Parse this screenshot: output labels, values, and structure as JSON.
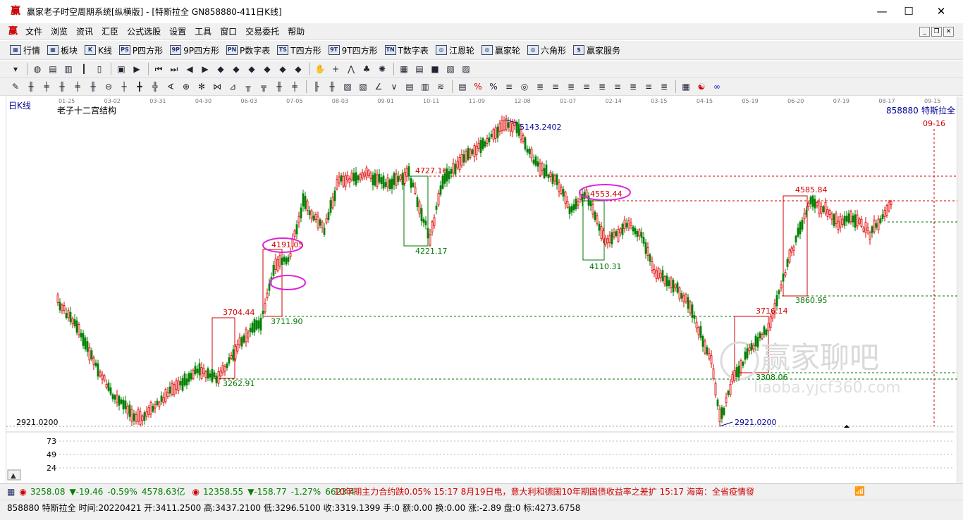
{
  "window": {
    "title": "赢家老子时空周期系统[纵横版] - [特斯拉全  GN858880-411日K线]",
    "logo": "赢",
    "minimize": "—",
    "maximize": "☐",
    "close": "✕"
  },
  "menu": {
    "logo": "赢",
    "items": [
      "文件",
      "浏览",
      "资讯",
      "汇臣",
      "公式选股",
      "设置",
      "工具",
      "窗口",
      "交易委托",
      "帮助"
    ]
  },
  "nav": {
    "items": [
      {
        "icon": "▦",
        "label": "行情"
      },
      {
        "icon": "▦",
        "label": "板块"
      },
      {
        "icon": "K",
        "label": "K线"
      },
      {
        "icon": "PS",
        "label": "P四方形"
      },
      {
        "icon": "9P",
        "label": "9P四方形"
      },
      {
        "icon": "PN",
        "label": "P数字表"
      },
      {
        "icon": "TS",
        "label": "T四方形"
      },
      {
        "icon": "9T",
        "label": "9T四方形"
      },
      {
        "icon": "TN",
        "label": "T数字表"
      },
      {
        "icon": "◎",
        "label": "江恩轮"
      },
      {
        "icon": "◎",
        "label": "赢家轮"
      },
      {
        "icon": "◎",
        "label": "六角形"
      },
      {
        "icon": "$",
        "label": "赢家服务"
      }
    ]
  },
  "chart": {
    "period_label": "日K线",
    "indicator_name": "老子十二宫结构",
    "symbol_code": "858880",
    "symbol_name": "特斯拉全",
    "future_date": "09-16",
    "axis_low": "2921.0200",
    "x_ticks": [
      "01-25",
      "03-02",
      "03-31",
      "04-30",
      "06-03",
      "07-05",
      "08-03",
      "09-01",
      "10-11",
      "11-09",
      "12-08",
      "01-07",
      "02-14",
      "03-15",
      "04-15",
      "05-19",
      "06-20",
      "07-19",
      "08-17",
      "09-15"
    ],
    "annotations": {
      "low_main": "2921.0200",
      "high_main": "5143.2402",
      "a3262": "3262.91",
      "a3704": "3704.44",
      "a3711": "3711.90",
      "a4191": "4191.05",
      "a4221": "4221.17",
      "a4727": "4727.16",
      "a4553": "4553.44",
      "a4110": "4110.31",
      "a3716": "3716.14",
      "a3308": "3308.06",
      "a3860": "3860.95",
      "a4585": "4585.84"
    },
    "watermark_cn": "赢家聊吧",
    "watermark_en": "liaoba.yjcf360.com",
    "sub_ticks": [
      "73",
      "49",
      "24"
    ],
    "colors": {
      "up": "#e00000",
      "down": "#008000",
      "annot_red": "#d00000",
      "annot_green": "#007700",
      "annot_blue": "#000099",
      "magenta": "#dd22dd"
    }
  },
  "status1": {
    "sh_index": "3258.08",
    "sh_change": "▼-19.46",
    "sh_pct": "-0.59%",
    "sh_amount": "4578.63亿",
    "sz_index": "12358.55",
    "sz_change": "▼-158.77",
    "sz_pct": "-1.27%",
    "sz_amount": "6623.4",
    "news": "10年期主力合约跌0.05%   15:17  8月19日电，意大利和德国10年期国债收益率之差扩   15:17  海南：全省疫情發"
  },
  "status2": {
    "text": "858880 特斯拉全 时间:20220421 开:3411.2500 高:3437.2100 低:3296.5100 收:3319.1399 手:0 额:0.00 换:0.00 涨:-2.89 盘:0 标:4273.6758"
  }
}
